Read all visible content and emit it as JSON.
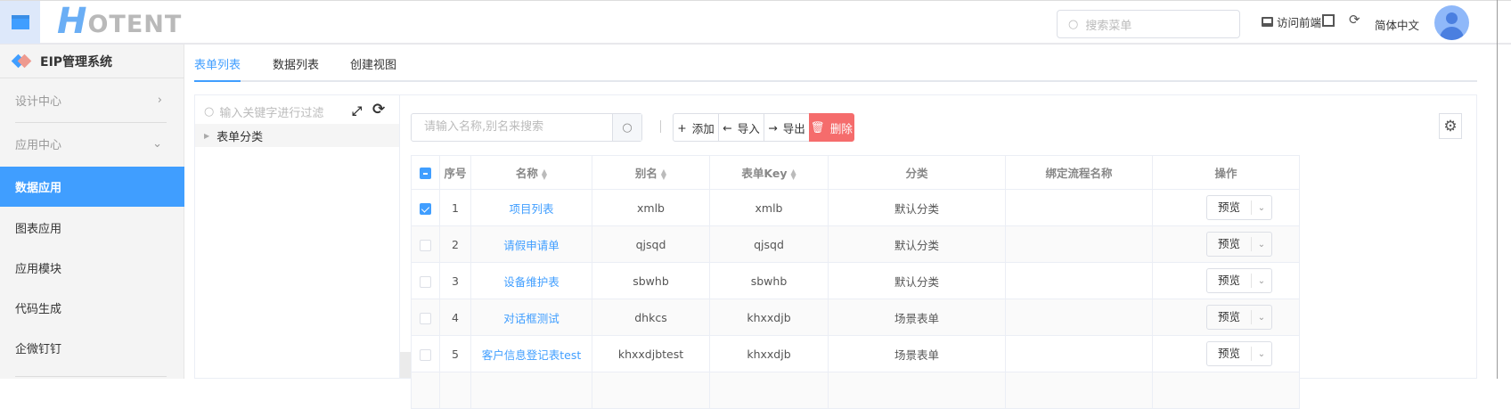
{
  "header": {
    "logo": "HOTENT",
    "search_placeholder": "搜索菜单",
    "visit_frontend": "访问前端",
    "language": "简体中文"
  },
  "sidebar": {
    "title": "EIP管理系统",
    "items": [
      {
        "label": "设计中心"
      },
      {
        "label": "应用中心"
      },
      {
        "label": "数据应用"
      },
      {
        "label": "图表应用"
      },
      {
        "label": "应用模块"
      },
      {
        "label": "代码生成"
      },
      {
        "label": "企微钉钉"
      }
    ]
  },
  "tabs": [
    {
      "label": "表单列表"
    },
    {
      "label": "数据列表"
    },
    {
      "label": "创建视图"
    }
  ],
  "tree": {
    "filter_placeholder": "输入关键字进行过滤",
    "root": "表单分类"
  },
  "toolbar": {
    "search_placeholder": "请输入名称,别名来搜索",
    "add": "添加",
    "import": "导入",
    "export": "导出",
    "delete": "删除"
  },
  "table": {
    "headers": [
      "序号",
      "名称",
      "别名",
      "表单Key",
      "分类",
      "绑定流程名称",
      "操作"
    ],
    "preview": "预览",
    "rows": [
      {
        "no": "1",
        "name": "项目列表",
        "alias": "xmlb",
        "key": "xmlb",
        "category": "默认分类",
        "flow": "",
        "checked": true
      },
      {
        "no": "2",
        "name": "请假申请单",
        "alias": "qjsqd",
        "key": "qjsqd",
        "category": "默认分类",
        "flow": "",
        "checked": false
      },
      {
        "no": "3",
        "name": "设备维护表",
        "alias": "sbwhb",
        "key": "sbwhb",
        "category": "默认分类",
        "flow": "",
        "checked": false
      },
      {
        "no": "4",
        "name": "对话框测试",
        "alias": "dhkcs",
        "key": "khxxdjb",
        "category": "场景表单",
        "flow": "",
        "checked": false
      },
      {
        "no": "5",
        "name": "客户信息登记表test",
        "alias": "khxxdjbtest",
        "key": "khxxdjb",
        "category": "场景表单",
        "flow": "",
        "checked": false
      }
    ]
  },
  "colors": {
    "primary": "#409eff",
    "danger": "#f56c6c"
  }
}
